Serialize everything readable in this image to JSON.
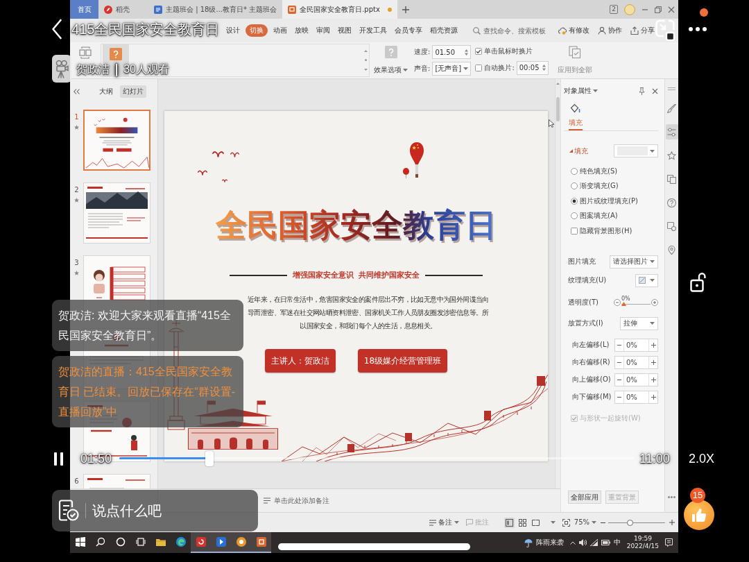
{
  "player": {
    "title": "415全民国家安全教育日",
    "host": "贺政洁",
    "separator": "|",
    "viewers": "30人观看",
    "notification": true,
    "locked": false,
    "playing": true,
    "current_time": "01:50",
    "progress": {
      "level": 0.17
    },
    "duration": "11:00",
    "speed": "2.0X",
    "comment_placeholder": "说点什么吧",
    "likes": "15"
  },
  "chat": [
    {
      "kind": "message",
      "text": "贺政洁: 欢迎大家来观看直播“415全民国家安全教育日”。"
    },
    {
      "kind": "notice",
      "text": "贺政洁的直播：415全民国家安全教育日 已结束。回放已保存在“群设置-直播回放”中"
    }
  ],
  "screen": {
    "tabs": [
      {
        "kind": "home",
        "label": "首页",
        "selected": false,
        "modified": false
      },
      {
        "kind": "docer",
        "label": "稻壳",
        "selected": false,
        "modified": false
      },
      {
        "kind": "writer",
        "label": "主题班会 | 18级...教育日* 主题班会",
        "selected": false,
        "modified": false
      },
      {
        "kind": "presentation",
        "label": "全民国家安全教育日.pptx",
        "selected": true,
        "modified": true
      }
    ],
    "window_count": "2",
    "menu": [
      {
        "label": "设计",
        "selected": false
      },
      {
        "label": "切换",
        "selected": true
      },
      {
        "label": "动画",
        "selected": false
      },
      {
        "label": "放映",
        "selected": false
      },
      {
        "label": "审阅",
        "selected": false
      },
      {
        "label": "视图",
        "selected": false
      },
      {
        "label": "开发工具",
        "selected": false
      },
      {
        "label": "会员专享",
        "selected": false
      },
      {
        "label": "稻壳资源",
        "selected": false
      }
    ],
    "search": {
      "placeholder": "查找命令、搜索模板"
    },
    "actions": [
      {
        "kind": "modified",
        "label": "有修改"
      },
      {
        "kind": "collaborate",
        "label": "协作"
      },
      {
        "kind": "share",
        "label": "分享"
      }
    ],
    "ribbon": {
      "transitions": [
        {
          "selected": true
        }
      ],
      "effect_options": "效果选项",
      "speed_label": "速度:",
      "speed": "01.50",
      "sound_label": "声音:",
      "sound": "[无声音]",
      "on_click": {
        "label": "单击鼠标时换片",
        "checked": true
      },
      "auto": {
        "label": "自动换片:",
        "checked": false
      },
      "auto_time": "00:05",
      "apply_all": "应用到全部"
    },
    "panel_tabs": [
      {
        "label": "大纲",
        "selected": false
      },
      {
        "label": "幻灯片",
        "selected": true
      }
    ],
    "thumbnails": [
      {
        "number": "1",
        "selected": true,
        "animated": true
      },
      {
        "number": "2",
        "selected": false,
        "animated": true
      },
      {
        "number": "3",
        "selected": false,
        "animated": true
      },
      {
        "selected": false,
        "animated": false
      },
      {
        "selected": false,
        "animated": false
      },
      {
        "number": "6",
        "selected": false,
        "animated": false
      }
    ],
    "slide": {
      "title": "全民国家安全教育日",
      "subtitle": "增强国家安全意识  共同维护国家安全",
      "body": "近年来，在日常生活中，危害国家安全的案件层出不穷，比如无意中为国外间谍当向导而泄密、军迷在社交网站晒资料泄密、国家机关工作人员朋友圈发涉密信息等。所以国家安全，和我们每个人的生活，息息相关。",
      "buttons": [
        "主讲人：贺政洁",
        "18级媒介经营管理班"
      ]
    },
    "notes": {
      "placeholder": "单击此处添加备注"
    },
    "properties": {
      "title": "对象属性",
      "tabs": [
        {
          "label": "填充",
          "selected": true
        }
      ],
      "section": "填充",
      "fill_types": [
        {
          "label": "纯色填充(S)",
          "selected": false
        },
        {
          "label": "渐变填充(G)",
          "selected": false
        },
        {
          "label": "图片或纹理填充(P)",
          "selected": true
        },
        {
          "label": "图案填充(A)",
          "selected": false
        }
      ],
      "hide_background": {
        "label": "隐藏背景图形(H)",
        "checked": false
      },
      "picture_fill": {
        "label": "图片填充",
        "value": "请选择图片"
      },
      "texture_fill": {
        "label": "纹理填充(U)"
      },
      "transparency": {
        "label": "透明度(T)",
        "reading": "0%",
        "level": 0
      },
      "placement": {
        "label": "放置方式(I)",
        "value": "拉伸"
      },
      "offsets": [
        {
          "label": "向左偏移(L)",
          "value": "0%"
        },
        {
          "label": "向右偏移(R)",
          "value": "0%"
        },
        {
          "label": "向上偏移(O)",
          "value": "0%"
        },
        {
          "label": "向下偏移(M)",
          "value": "0%"
        }
      ],
      "rotate": {
        "label": "与形状一起旋转(W)",
        "checked": true,
        "disabled": true
      },
      "buttons": [
        {
          "label": "全部应用",
          "disabled": false
        },
        {
          "label": "重置背景",
          "disabled": true
        }
      ]
    },
    "tools": [
      {
        "selected": false
      },
      {
        "selected": true
      },
      {
        "selected": false
      },
      {
        "selected": false
      },
      {
        "selected": false
      },
      {
        "selected": false
      },
      {
        "selected": false
      }
    ],
    "status": {
      "notes": "备注",
      "comments": {
        "label": "批注",
        "disabled": true
      },
      "views": [
        {
          "selected": true
        },
        {
          "selected": false
        },
        {
          "selected": false
        }
      ],
      "zoom": "75%",
      "zoom_slider": {
        "level": 0.37
      }
    },
    "taskbar": {
      "apps": [
        {
          "running": false
        },
        {
          "running": false
        },
        {
          "running": true
        },
        {
          "running": true
        },
        {
          "running": true
        },
        {
          "running": true
        }
      ],
      "weather": "阵雨来袭",
      "ime": "中",
      "time": "19:59",
      "date": "2022/4/15"
    }
  }
}
